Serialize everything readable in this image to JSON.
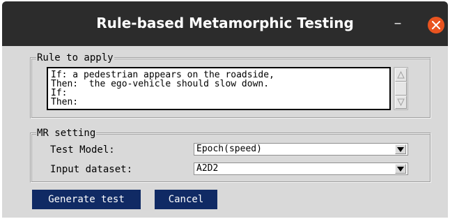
{
  "window": {
    "title": "Rule-based Metamorphic Testing",
    "minimize_glyph": "–",
    "close_icon": "close-icon",
    "accent_close": "#e95420"
  },
  "rule": {
    "legend": "Rule to apply",
    "lines": [
      "If: a pedestrian appears on the roadside,",
      "Then:  the ego-vehicle should slow down.",
      "If:",
      "Then:"
    ]
  },
  "mr": {
    "legend": "MR setting",
    "test_model_label": "Test Model:",
    "test_model_value": "Epoch(speed)",
    "dataset_label": "Input dataset:",
    "dataset_value": "A2D2"
  },
  "buttons": {
    "generate": "Generate test",
    "cancel": "Cancel",
    "color": "#102a64"
  }
}
